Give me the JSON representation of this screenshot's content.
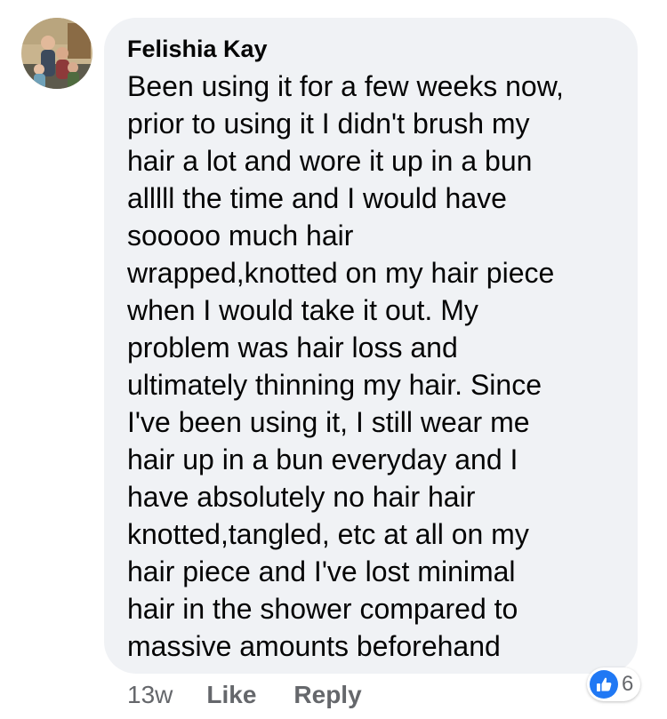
{
  "comment": {
    "author": "Felishia Kay",
    "lines": [
      "Been using it for a few weeks now,",
      "prior to using it I didn't brush my",
      "hair a lot and wore it up in a bun",
      "alllll the time and I would have",
      "sooooo much hair",
      "wrapped,knotted on my hair piece",
      "when I would take it out. My",
      "problem was hair loss and",
      "ultimately thinning my hair. Since",
      "I've been using it, I still wear me",
      "hair up in a bun everyday and I",
      "have absolutely no hair hair",
      "knotted,tangled, etc at all on my",
      "hair piece and I've lost minimal",
      "hair in the shower compared to",
      "massive amounts beforehand"
    ]
  },
  "actions": {
    "time": "13w",
    "like_label": "Like",
    "reply_label": "Reply"
  },
  "reactions": {
    "icon": "thumbs-up-icon",
    "count": "6"
  },
  "colors": {
    "bubble": "#f0f2f5",
    "meta_text": "#65676b",
    "like_blue": "#2078f4"
  }
}
